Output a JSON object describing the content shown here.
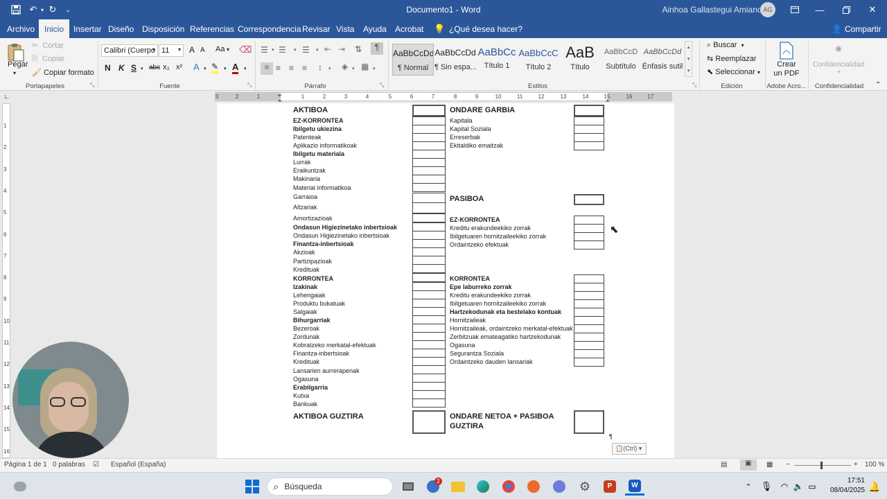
{
  "app": {
    "doc_title": "Documento1",
    "app_name": "Word",
    "user": "Ainhoa Gallastegui Amiano",
    "initials": "AG"
  },
  "tabs": [
    "Archivo",
    "Inicio",
    "Insertar",
    "Diseño",
    "Disposición",
    "Referencias",
    "Correspondencia",
    "Revisar",
    "Vista",
    "Ayuda",
    "Acrobat"
  ],
  "tell_me": "¿Qué desea hacer?",
  "share": "Compartir",
  "clipboard": {
    "paste": "Pegar",
    "cut": "Cortar",
    "copy": "Copiar",
    "format_painter": "Copiar formato",
    "label": "Portapapeles"
  },
  "font": {
    "name": "Calibri (Cuerpo",
    "size": "11",
    "label": "Fuente",
    "bold": "N",
    "italic": "K",
    "underline": "S",
    "strike": "abc",
    "sub": "x₂",
    "sup": "x²",
    "change_case": "Aa",
    "grow": "A",
    "shrink": "A"
  },
  "paragraph": {
    "label": "Párrafo"
  },
  "styles": {
    "label": "Estilos",
    "items": [
      {
        "preview": "AaBbCcDd",
        "name": "¶ Normal"
      },
      {
        "preview": "AaBbCcDd",
        "name": "¶ Sin espa..."
      },
      {
        "preview": "AaBbCc",
        "name": "Título 1"
      },
      {
        "preview": "AaBbCcC",
        "name": "Título 2"
      },
      {
        "preview": "AaB",
        "name": "Título"
      },
      {
        "preview": "AaBbCcD",
        "name": "Subtítulo"
      },
      {
        "preview": "AaBbCcDd",
        "name": "Énfasis sutil"
      }
    ]
  },
  "editing": {
    "find": "Buscar",
    "replace": "Reemplazar",
    "select": "Seleccionar",
    "label": "Edición"
  },
  "adobe": {
    "create_pdf_line1": "Crear",
    "create_pdf_line2": "un PDF",
    "label": "Adobe Acro..."
  },
  "sensitivity": {
    "button": "Confidencialidad",
    "label": "Confidencialidad"
  },
  "ruler": {
    "numbers": [
      "3",
      "2",
      "1",
      "1",
      "2",
      "3",
      "4",
      "5",
      "6",
      "7",
      "8",
      "9",
      "10",
      "11",
      "12",
      "13",
      "14",
      "15",
      "16",
      "17"
    ],
    "vnumbers": [
      "1",
      "2",
      "3",
      "4",
      "5",
      "6",
      "7",
      "8",
      "9",
      "10",
      "11",
      "12",
      "13",
      "14",
      "15",
      "16"
    ]
  },
  "balance": {
    "left": [
      {
        "t": "AKTIBOA",
        "s": "h"
      },
      {
        "t": "EZ-KORRONTEA",
        "s": "b"
      },
      {
        "t": "Ibilgetu ukiezina",
        "s": "b"
      },
      {
        "t": "Patenteak",
        "s": ""
      },
      {
        "t": "Aplikazio informatikoak",
        "s": ""
      },
      {
        "t": "Ibilgetu materiala",
        "s": "b"
      },
      {
        "t": "Lurrak",
        "s": ""
      },
      {
        "t": "Eraikuntzak",
        "s": ""
      },
      {
        "t": "Makinaria",
        "s": ""
      },
      {
        "t": "Material informatikoa",
        "s": ""
      },
      {
        "t": "Garraioa",
        "s": ""
      },
      {
        "t": "Altzariak",
        "s": ""
      },
      {
        "t": "Amortizazioak",
        "s": ""
      },
      {
        "t": "Ondasun Higiezinetako inbertsioak",
        "s": "b"
      },
      {
        "t": "Ondasun Higiezinetako inbertsioak",
        "s": ""
      },
      {
        "t": "Finantza-inbertsioak",
        "s": "b"
      },
      {
        "t": "Akzioak",
        "s": ""
      },
      {
        "t": "Partizipazioak",
        "s": ""
      },
      {
        "t": "Kredituak",
        "s": ""
      },
      {
        "t": "KORRONTEA",
        "s": "b"
      },
      {
        "t": "Izakinak",
        "s": "b"
      },
      {
        "t": "Lehengaiak",
        "s": ""
      },
      {
        "t": "Produktu bukatuak",
        "s": ""
      },
      {
        "t": "Salgaiak",
        "s": ""
      },
      {
        "t": "Bihurgarriak",
        "s": "b"
      },
      {
        "t": "Bezeroak",
        "s": ""
      },
      {
        "t": "Zordunak",
        "s": ""
      },
      {
        "t": "Kobratzeko merkatal-efektuak",
        "s": ""
      },
      {
        "t": "Finantza-inbertsioak",
        "s": ""
      },
      {
        "t": "Kredituak",
        "s": ""
      },
      {
        "t": "Lansarien aurrerapenak",
        "s": ""
      },
      {
        "t": "Ogasuna",
        "s": ""
      },
      {
        "t": "Erabilgarria",
        "s": "b"
      },
      {
        "t": "Kutxa",
        "s": ""
      },
      {
        "t": "Bankuak",
        "s": ""
      },
      {
        "t": "AKTIBOA GUZTIRA",
        "s": "h"
      }
    ],
    "right_equity": [
      {
        "t": "ONDARE GARBIA",
        "s": "h"
      },
      {
        "t": "Kapitala",
        "s": ""
      },
      {
        "t": "Kapital Soziala",
        "s": ""
      },
      {
        "t": "Erreserbak",
        "s": ""
      },
      {
        "t": "Ekitaldiko emaitzak",
        "s": ""
      }
    ],
    "right_liab": [
      {
        "t": "PASIBOA",
        "s": "h"
      },
      {
        "t": "EZ-KORRONTEA",
        "s": "b"
      },
      {
        "t": "Kreditu erakundeekiko zorrak",
        "s": ""
      },
      {
        "t": "Ibilgetuaren hornitzaileekiko zorrak",
        "s": ""
      },
      {
        "t": "Ordaintzeko efektuak",
        "s": ""
      },
      {
        "t": "KORRONTEA",
        "s": "b"
      },
      {
        "t": "Epe laburreko zorrak",
        "s": "b"
      },
      {
        "t": "Kreditu erakundeekiko zorrak",
        "s": ""
      },
      {
        "t": "Ibilgetuaren hornitzaileekiko zorrak",
        "s": ""
      },
      {
        "t": "Hartzekodunak eta bestelako kontuak",
        "s": "b"
      },
      {
        "t": "Hornitzaileak",
        "s": ""
      },
      {
        "t": "Hornitzaileak, ordaintzeko merkatal-efektuak",
        "s": ""
      },
      {
        "t": "Zerbitzuak emateagatiko hartzekodunak",
        "s": ""
      },
      {
        "t": "Ogasuna",
        "s": ""
      },
      {
        "t": "Segurantza Soziala",
        "s": ""
      },
      {
        "t": "Ordaintzeko dauden lansariak",
        "s": ""
      }
    ],
    "total_right_l1": "ONDARE NETOA + PASIBOA",
    "total_right_l2": "GUZTIRA",
    "paste_options": "(Ctrl)",
    "pilcrow": "¶"
  },
  "status": {
    "page": "Página 1 de 1",
    "words": "0 palabras",
    "language": "Español (España)",
    "zoom": "100 %"
  },
  "taskbar": {
    "search": "Búsqueda",
    "time": "17:51",
    "date": "08/04/2025",
    "badge": "2"
  },
  "colors": {
    "word_blue": "#2b579a",
    "ribbon_bg": "#f3f3f3",
    "accent_red": "#c00000"
  }
}
